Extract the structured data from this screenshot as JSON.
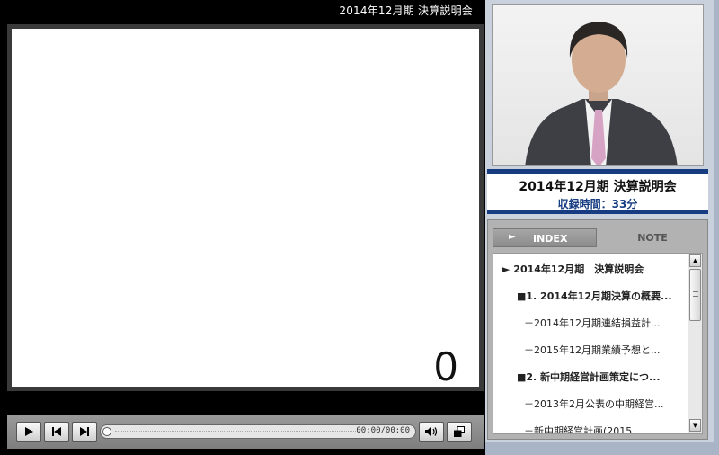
{
  "player": {
    "title": "2014年12月期 決算説明会",
    "slide_number": "0",
    "time": "00:00/00:00",
    "progress": 0
  },
  "controls": {
    "play_icon": "play-icon",
    "prev_icon": "skip-back-icon",
    "next_icon": "skip-forward-icon",
    "volume_icon": "speaker-icon",
    "popout_icon": "window-switch-icon"
  },
  "lecture": {
    "title": "2014年12月期 決算説明会",
    "duration": "収録時間：33分"
  },
  "tabs": {
    "index": "INDEX",
    "note": "NOTE",
    "active": "index"
  },
  "index_items": [
    "► 2014年12月期　決算説明会",
    "■1. 2014年12月期決算の概要...",
    "－2014年12月期連結損益計...",
    "－2015年12月期業績予想と...",
    "■2. 新中期経営計画策定につ...",
    "－2013年2月公表の中期経営...",
    "－新中期経営計画(2015..."
  ],
  "colors": {
    "accent_navy": "#173c82",
    "player_bg": "#000000",
    "sidebar_bg": "#c9d1dc"
  }
}
